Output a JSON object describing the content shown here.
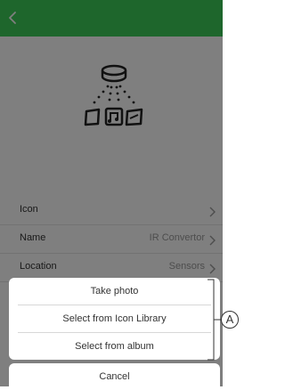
{
  "header": {
    "back_icon": "chevron-left-icon"
  },
  "device": {
    "icon": "ir-convertor-device-icon"
  },
  "settings": {
    "rows": [
      {
        "label": "Icon",
        "value": ""
      },
      {
        "label": "Name",
        "value": "IR Convertor"
      },
      {
        "label": "Location",
        "value": "Sensors"
      }
    ]
  },
  "action_sheet": {
    "options": [
      {
        "label": "Take photo"
      },
      {
        "label": "Select from Icon Library"
      },
      {
        "label": "Select from album"
      }
    ],
    "cancel_label": "Cancel"
  },
  "callout": {
    "label": "A"
  },
  "colors": {
    "header": "#3dcd58",
    "overlay": "rgba(0,0,0,0.5)"
  }
}
